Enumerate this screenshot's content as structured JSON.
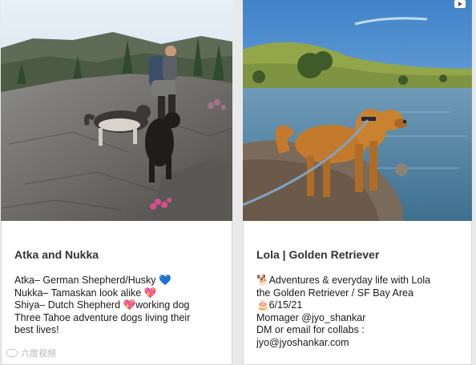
{
  "cards": [
    {
      "title": "Atka and Nukka",
      "lines": [
        "Atka– German Shepherd/Husky 💙",
        "Nukka– Tamaskan look alike 💖",
        "Shiya– Dutch Shepherd 💖working dog",
        "Three Tahoe adventure dogs living their",
        "best lives!"
      ],
      "photo_subject": "hiker-with-husky-dogs-on-rocks"
    },
    {
      "title": "Lola | Golden Retriever",
      "lines": [
        "🐕Adventures & everyday life with Lola",
        "the Golden Retriever / SF Bay Area",
        "🎂6/15/21",
        "Momager @jyo_shankar",
        "DM or email for collabs :",
        "jyo@jyoshankar.com"
      ],
      "photo_subject": "golden-retriever-by-lake"
    }
  ],
  "watermark": {
    "text": "六度视频"
  },
  "colors": {
    "card_bg": "#ffffff",
    "page_bg": "#e9e9e9",
    "title": "#333333",
    "text": "#1a1a1a"
  }
}
